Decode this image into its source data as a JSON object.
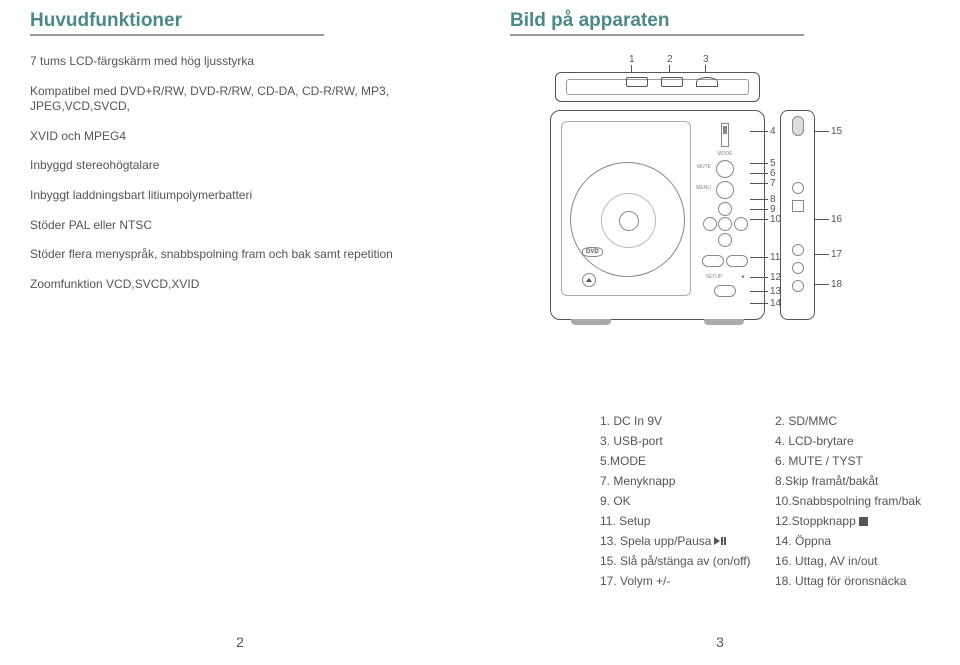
{
  "left": {
    "title": "Huvudfunktioner",
    "features": [
      "7 tums LCD-färgskärm med hög ljusstyrka",
      "Kompatibel med DVD+R/RW, DVD-R/RW, CD-DA, CD-R/RW, MP3, JPEG,VCD,SVCD,",
      "XVID och MPEG4",
      "Inbyggd stereohögtalare",
      "Inbyggt laddningsbart litiumpolymerbatteri",
      "Stöder PAL eller NTSC",
      "Stöder flera menyspråk, snabbspolning fram och bak samt repetition",
      "Zoomfunktion VCD,SVCD,XVID"
    ],
    "page": "2"
  },
  "right": {
    "title": "Bild på apparaten",
    "top_callouts": [
      "1",
      "2",
      "3"
    ],
    "body_callouts": {
      "n4": "4",
      "n5": "5",
      "n6": "6",
      "n7": "7",
      "n8": "8",
      "n9": "9",
      "n10": "10",
      "n11": "11",
      "n12": "12",
      "n13": "13",
      "n14": "14"
    },
    "side_callouts": {
      "n15": "15",
      "n16": "16",
      "n17": "17",
      "n18": "18"
    },
    "ctrl_labels": {
      "menu": "MENU",
      "mute": "MUTE",
      "setup": "SETUP",
      "mode": "MODE",
      "dvd": "DVD"
    },
    "legend": [
      {
        "l": "1. DC In 9V",
        "r": "2. SD/MMC"
      },
      {
        "l": "3. USB-port",
        "r": "4. LCD-brytare"
      },
      {
        "l": "5.MODE",
        "r": "6. MUTE / TYST"
      },
      {
        "l": "7. Menyknapp",
        "r": "8.Skip framåt/bakåt"
      },
      {
        "l": "9. OK",
        "r": "10.Snabbspolning fram/bak"
      },
      {
        "l": "11. Setup",
        "r": "12.Stoppknapp"
      },
      {
        "l": "13. Spela upp/Pausa",
        "r": "14. Öppna"
      },
      {
        "l": "15. Slå på/stänga av (on/off)",
        "r": "16. Uttag, AV in/out"
      },
      {
        "l": "17. Volym +/-",
        "r": "18. Uttag för öronsnäcka"
      }
    ],
    "page": "3"
  }
}
